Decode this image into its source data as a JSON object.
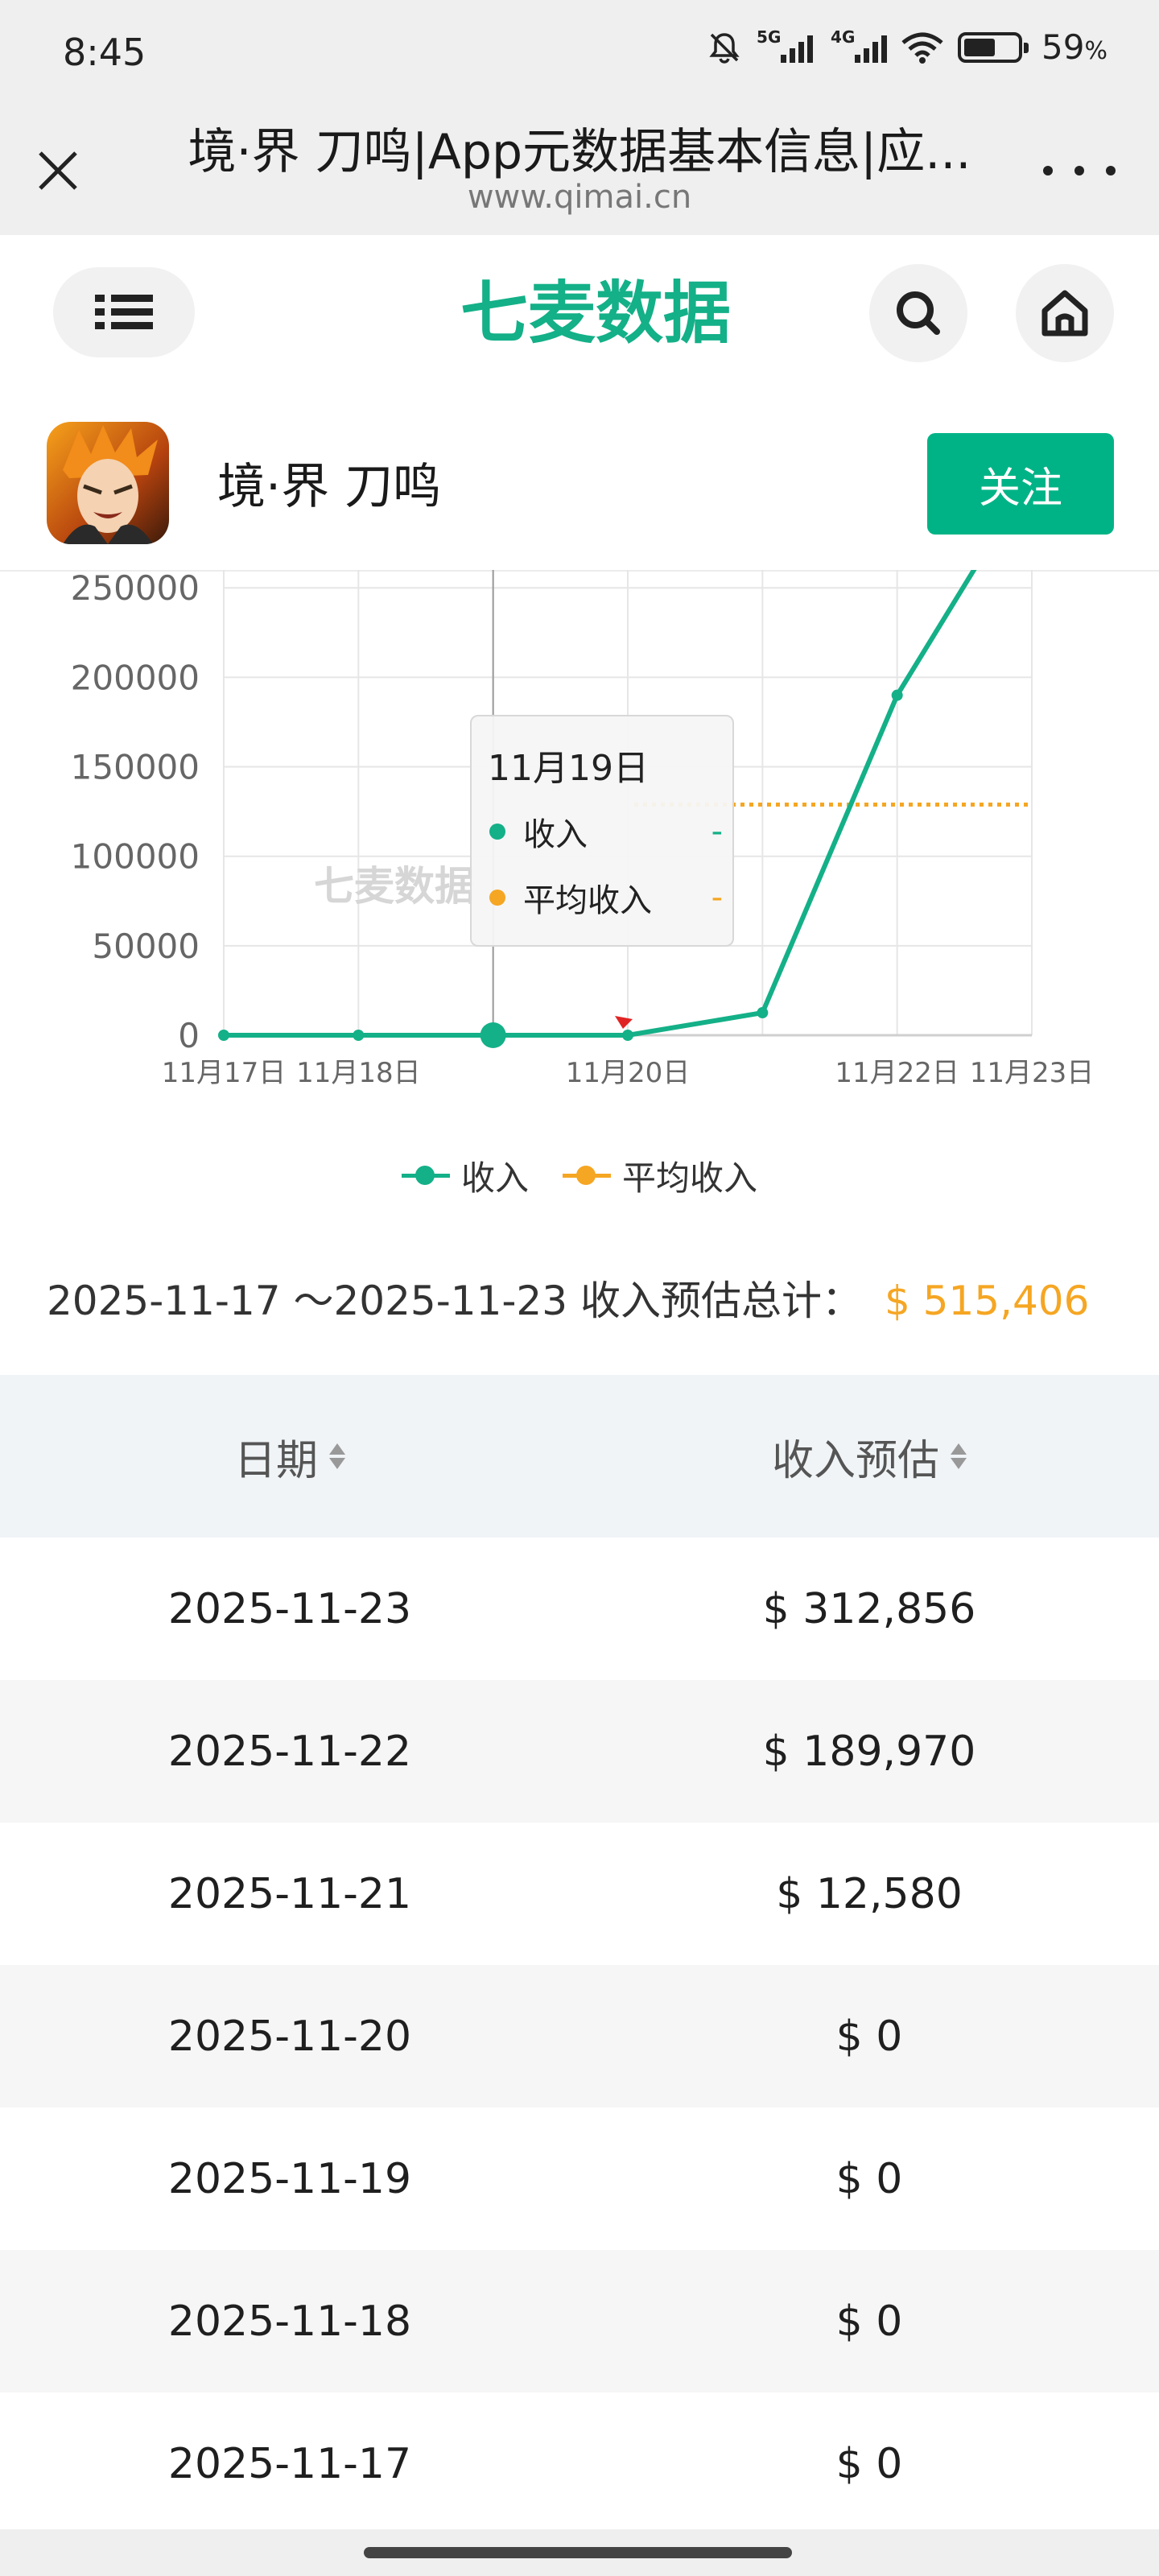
{
  "status": {
    "time": "8:45",
    "net1": "5G",
    "net2": "4G",
    "battery": "59",
    "battery_unit": "%",
    "battery_level": 0.59
  },
  "browser": {
    "title": "境·界 刀鸣|App元数据基本信息|应...",
    "url": "www.qimai.cn"
  },
  "site": {
    "logo_text": "七麦数据"
  },
  "app": {
    "name": "境·界 刀鸣",
    "follow_label": "关注"
  },
  "chart_data": {
    "type": "line",
    "x": [
      "11月17日",
      "11月18日",
      "11月19日",
      "11月20日",
      "11月21日",
      "11月22日",
      "11月23日"
    ],
    "x_tick_labels": [
      "11月17日",
      "11月18日",
      "",
      "11月20日",
      "",
      "11月22日",
      "11月23日"
    ],
    "series": [
      {
        "name": "收入",
        "values": [
          0,
          0,
          0,
          0,
          12580,
          189970,
          312856
        ],
        "color": "#14b088"
      },
      {
        "name": "平均收入",
        "values": [
          128880,
          128880,
          128880,
          128880,
          128880,
          128880,
          128880
        ],
        "color": "#f5a623",
        "style": "dotted",
        "visible_from": "11月20日"
      }
    ],
    "y_ticks": [
      0,
      50000,
      100000,
      150000,
      200000,
      250000
    ],
    "ylim": [
      0,
      260000
    ],
    "grid": true,
    "legend": "bottom-center",
    "watermark": "七麦数据",
    "tooltip": {
      "date": "11月19日",
      "rows": [
        {
          "label": "收入",
          "value": "-",
          "color": "#14b088"
        },
        {
          "label": "平均收入",
          "value": "-",
          "color": "#f5a623"
        }
      ]
    }
  },
  "legend": [
    {
      "label": "收入",
      "color": "#14b088"
    },
    {
      "label": "平均收入",
      "color": "#f5a623"
    }
  ],
  "summary": {
    "label": "2025-11-17 ～2025-11-23 收入预估总计：",
    "value": "$ 515,406"
  },
  "table": {
    "headers": [
      "日期",
      "收入预估"
    ],
    "rows": [
      [
        "2025-11-23",
        "$ 312,856"
      ],
      [
        "2025-11-22",
        "$ 189,970"
      ],
      [
        "2025-11-21",
        "$ 12,580"
      ],
      [
        "2025-11-20",
        "$ 0"
      ],
      [
        "2025-11-19",
        "$ 0"
      ],
      [
        "2025-11-18",
        "$ 0"
      ],
      [
        "2025-11-17",
        "$ 0"
      ]
    ]
  },
  "colors": {
    "accent": "#00b386",
    "total": "#f5a623"
  }
}
